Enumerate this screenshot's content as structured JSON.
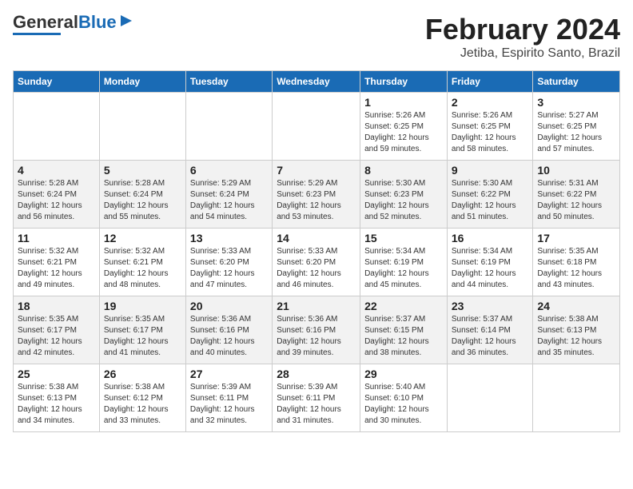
{
  "logo": {
    "general": "General",
    "blue": "Blue"
  },
  "title": "February 2024",
  "subtitle": "Jetiba, Espirito Santo, Brazil",
  "days_of_week": [
    "Sunday",
    "Monday",
    "Tuesday",
    "Wednesday",
    "Thursday",
    "Friday",
    "Saturday"
  ],
  "weeks": [
    [
      {
        "num": "",
        "info": ""
      },
      {
        "num": "",
        "info": ""
      },
      {
        "num": "",
        "info": ""
      },
      {
        "num": "",
        "info": ""
      },
      {
        "num": "1",
        "info": "Sunrise: 5:26 AM\nSunset: 6:25 PM\nDaylight: 12 hours\nand 59 minutes."
      },
      {
        "num": "2",
        "info": "Sunrise: 5:26 AM\nSunset: 6:25 PM\nDaylight: 12 hours\nand 58 minutes."
      },
      {
        "num": "3",
        "info": "Sunrise: 5:27 AM\nSunset: 6:25 PM\nDaylight: 12 hours\nand 57 minutes."
      }
    ],
    [
      {
        "num": "4",
        "info": "Sunrise: 5:28 AM\nSunset: 6:24 PM\nDaylight: 12 hours\nand 56 minutes."
      },
      {
        "num": "5",
        "info": "Sunrise: 5:28 AM\nSunset: 6:24 PM\nDaylight: 12 hours\nand 55 minutes."
      },
      {
        "num": "6",
        "info": "Sunrise: 5:29 AM\nSunset: 6:24 PM\nDaylight: 12 hours\nand 54 minutes."
      },
      {
        "num": "7",
        "info": "Sunrise: 5:29 AM\nSunset: 6:23 PM\nDaylight: 12 hours\nand 53 minutes."
      },
      {
        "num": "8",
        "info": "Sunrise: 5:30 AM\nSunset: 6:23 PM\nDaylight: 12 hours\nand 52 minutes."
      },
      {
        "num": "9",
        "info": "Sunrise: 5:30 AM\nSunset: 6:22 PM\nDaylight: 12 hours\nand 51 minutes."
      },
      {
        "num": "10",
        "info": "Sunrise: 5:31 AM\nSunset: 6:22 PM\nDaylight: 12 hours\nand 50 minutes."
      }
    ],
    [
      {
        "num": "11",
        "info": "Sunrise: 5:32 AM\nSunset: 6:21 PM\nDaylight: 12 hours\nand 49 minutes."
      },
      {
        "num": "12",
        "info": "Sunrise: 5:32 AM\nSunset: 6:21 PM\nDaylight: 12 hours\nand 48 minutes."
      },
      {
        "num": "13",
        "info": "Sunrise: 5:33 AM\nSunset: 6:20 PM\nDaylight: 12 hours\nand 47 minutes."
      },
      {
        "num": "14",
        "info": "Sunrise: 5:33 AM\nSunset: 6:20 PM\nDaylight: 12 hours\nand 46 minutes."
      },
      {
        "num": "15",
        "info": "Sunrise: 5:34 AM\nSunset: 6:19 PM\nDaylight: 12 hours\nand 45 minutes."
      },
      {
        "num": "16",
        "info": "Sunrise: 5:34 AM\nSunset: 6:19 PM\nDaylight: 12 hours\nand 44 minutes."
      },
      {
        "num": "17",
        "info": "Sunrise: 5:35 AM\nSunset: 6:18 PM\nDaylight: 12 hours\nand 43 minutes."
      }
    ],
    [
      {
        "num": "18",
        "info": "Sunrise: 5:35 AM\nSunset: 6:17 PM\nDaylight: 12 hours\nand 42 minutes."
      },
      {
        "num": "19",
        "info": "Sunrise: 5:35 AM\nSunset: 6:17 PM\nDaylight: 12 hours\nand 41 minutes."
      },
      {
        "num": "20",
        "info": "Sunrise: 5:36 AM\nSunset: 6:16 PM\nDaylight: 12 hours\nand 40 minutes."
      },
      {
        "num": "21",
        "info": "Sunrise: 5:36 AM\nSunset: 6:16 PM\nDaylight: 12 hours\nand 39 minutes."
      },
      {
        "num": "22",
        "info": "Sunrise: 5:37 AM\nSunset: 6:15 PM\nDaylight: 12 hours\nand 38 minutes."
      },
      {
        "num": "23",
        "info": "Sunrise: 5:37 AM\nSunset: 6:14 PM\nDaylight: 12 hours\nand 36 minutes."
      },
      {
        "num": "24",
        "info": "Sunrise: 5:38 AM\nSunset: 6:13 PM\nDaylight: 12 hours\nand 35 minutes."
      }
    ],
    [
      {
        "num": "25",
        "info": "Sunrise: 5:38 AM\nSunset: 6:13 PM\nDaylight: 12 hours\nand 34 minutes."
      },
      {
        "num": "26",
        "info": "Sunrise: 5:38 AM\nSunset: 6:12 PM\nDaylight: 12 hours\nand 33 minutes."
      },
      {
        "num": "27",
        "info": "Sunrise: 5:39 AM\nSunset: 6:11 PM\nDaylight: 12 hours\nand 32 minutes."
      },
      {
        "num": "28",
        "info": "Sunrise: 5:39 AM\nSunset: 6:11 PM\nDaylight: 12 hours\nand 31 minutes."
      },
      {
        "num": "29",
        "info": "Sunrise: 5:40 AM\nSunset: 6:10 PM\nDaylight: 12 hours\nand 30 minutes."
      },
      {
        "num": "",
        "info": ""
      },
      {
        "num": "",
        "info": ""
      }
    ]
  ]
}
